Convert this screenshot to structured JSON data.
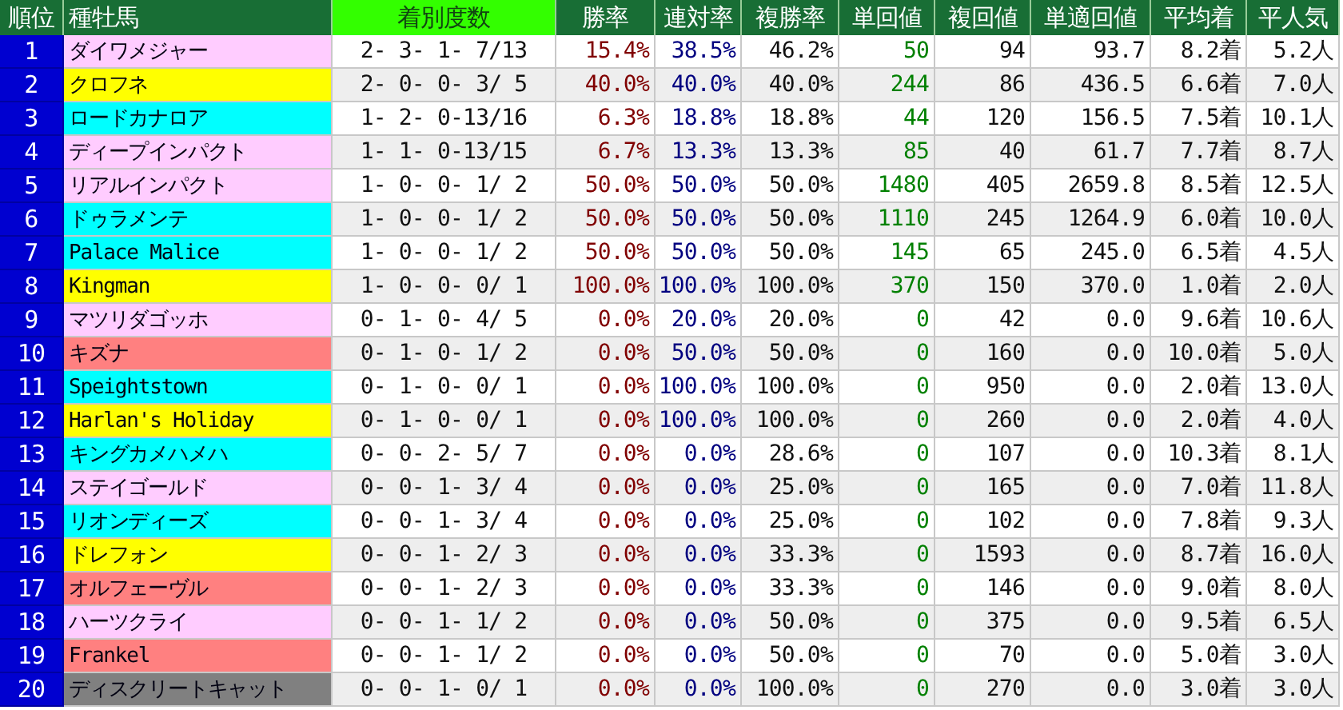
{
  "table": {
    "columns": [
      {
        "label": "順位",
        "selected": false
      },
      {
        "label": "種牡馬",
        "selected": false
      },
      {
        "label": "着別度数",
        "selected": true
      },
      {
        "label": "勝率",
        "selected": false
      },
      {
        "label": "連対率",
        "selected": false
      },
      {
        "label": "複勝率",
        "selected": false
      },
      {
        "label": "単回値",
        "selected": false
      },
      {
        "label": "複回値",
        "selected": false
      },
      {
        "label": "単適回値",
        "selected": false
      },
      {
        "label": "平均着",
        "selected": false
      },
      {
        "label": "平人気",
        "selected": false
      }
    ],
    "rows": [
      {
        "rank": "1",
        "sire": "ダイワメジャー",
        "color": "#ffccff",
        "record": "2- 3- 1- 7/13",
        "win_rate": "15.4%",
        "place_rate": "38.5%",
        "show_rate": "46.2%",
        "win_return": "50",
        "show_return": "94",
        "adj_win_return": "93.7",
        "avg_finish": "8.2着",
        "avg_pop": "5.2人"
      },
      {
        "rank": "2",
        "sire": "クロフネ",
        "color": "#ffff00",
        "record": "2- 0- 0- 3/ 5",
        "win_rate": "40.0%",
        "place_rate": "40.0%",
        "show_rate": "40.0%",
        "win_return": "244",
        "show_return": "86",
        "adj_win_return": "436.5",
        "avg_finish": "6.6着",
        "avg_pop": "7.0人"
      },
      {
        "rank": "3",
        "sire": "ロードカナロア",
        "color": "#00ffff",
        "record": "1- 2- 0-13/16",
        "win_rate": "6.3%",
        "place_rate": "18.8%",
        "show_rate": "18.8%",
        "win_return": "44",
        "show_return": "120",
        "adj_win_return": "156.5",
        "avg_finish": "7.5着",
        "avg_pop": "10.1人"
      },
      {
        "rank": "4",
        "sire": "ディープインパクト",
        "color": "#ffccff",
        "record": "1- 1- 0-13/15",
        "win_rate": "6.7%",
        "place_rate": "13.3%",
        "show_rate": "13.3%",
        "win_return": "85",
        "show_return": "40",
        "adj_win_return": "61.7",
        "avg_finish": "7.7着",
        "avg_pop": "8.7人"
      },
      {
        "rank": "5",
        "sire": "リアルインパクト",
        "color": "#ffccff",
        "record": "1- 0- 0- 1/ 2",
        "win_rate": "50.0%",
        "place_rate": "50.0%",
        "show_rate": "50.0%",
        "win_return": "1480",
        "show_return": "405",
        "adj_win_return": "2659.8",
        "avg_finish": "8.5着",
        "avg_pop": "12.5人"
      },
      {
        "rank": "6",
        "sire": "ドゥラメンテ",
        "color": "#00ffff",
        "record": "1- 0- 0- 1/ 2",
        "win_rate": "50.0%",
        "place_rate": "50.0%",
        "show_rate": "50.0%",
        "win_return": "1110",
        "show_return": "245",
        "adj_win_return": "1264.9",
        "avg_finish": "6.0着",
        "avg_pop": "10.0人"
      },
      {
        "rank": "7",
        "sire": "Palace Malice",
        "color": "#00ffff",
        "record": "1- 0- 0- 1/ 2",
        "win_rate": "50.0%",
        "place_rate": "50.0%",
        "show_rate": "50.0%",
        "win_return": "145",
        "show_return": "65",
        "adj_win_return": "245.0",
        "avg_finish": "6.5着",
        "avg_pop": "4.5人"
      },
      {
        "rank": "8",
        "sire": "Kingman",
        "color": "#ffff00",
        "record": "1- 0- 0- 0/ 1",
        "win_rate": "100.0%",
        "place_rate": "100.0%",
        "show_rate": "100.0%",
        "win_return": "370",
        "show_return": "150",
        "adj_win_return": "370.0",
        "avg_finish": "1.0着",
        "avg_pop": "2.0人"
      },
      {
        "rank": "9",
        "sire": "マツリダゴッホ",
        "color": "#ffccff",
        "record": "0- 1- 0- 4/ 5",
        "win_rate": "0.0%",
        "place_rate": "20.0%",
        "show_rate": "20.0%",
        "win_return": "0",
        "show_return": "42",
        "adj_win_return": "0.0",
        "avg_finish": "9.6着",
        "avg_pop": "10.6人"
      },
      {
        "rank": "10",
        "sire": "キズナ",
        "color": "#ff8080",
        "record": "0- 1- 0- 1/ 2",
        "win_rate": "0.0%",
        "place_rate": "50.0%",
        "show_rate": "50.0%",
        "win_return": "0",
        "show_return": "160",
        "adj_win_return": "0.0",
        "avg_finish": "10.0着",
        "avg_pop": "5.0人"
      },
      {
        "rank": "11",
        "sire": "Speightstown",
        "color": "#00ffff",
        "record": "0- 1- 0- 0/ 1",
        "win_rate": "0.0%",
        "place_rate": "100.0%",
        "show_rate": "100.0%",
        "win_return": "0",
        "show_return": "950",
        "adj_win_return": "0.0",
        "avg_finish": "2.0着",
        "avg_pop": "13.0人"
      },
      {
        "rank": "12",
        "sire": "Harlan's Holiday",
        "color": "#ffff00",
        "record": "0- 1- 0- 0/ 1",
        "win_rate": "0.0%",
        "place_rate": "100.0%",
        "show_rate": "100.0%",
        "win_return": "0",
        "show_return": "260",
        "adj_win_return": "0.0",
        "avg_finish": "2.0着",
        "avg_pop": "4.0人"
      },
      {
        "rank": "13",
        "sire": "キングカメハメハ",
        "color": "#00ffff",
        "record": "0- 0- 2- 5/ 7",
        "win_rate": "0.0%",
        "place_rate": "0.0%",
        "show_rate": "28.6%",
        "win_return": "0",
        "show_return": "107",
        "adj_win_return": "0.0",
        "avg_finish": "10.3着",
        "avg_pop": "8.1人"
      },
      {
        "rank": "14",
        "sire": "ステイゴールド",
        "color": "#ffccff",
        "record": "0- 0- 1- 3/ 4",
        "win_rate": "0.0%",
        "place_rate": "0.0%",
        "show_rate": "25.0%",
        "win_return": "0",
        "show_return": "165",
        "adj_win_return": "0.0",
        "avg_finish": "7.0着",
        "avg_pop": "11.8人"
      },
      {
        "rank": "15",
        "sire": "リオンディーズ",
        "color": "#00ffff",
        "record": "0- 0- 1- 3/ 4",
        "win_rate": "0.0%",
        "place_rate": "0.0%",
        "show_rate": "25.0%",
        "win_return": "0",
        "show_return": "102",
        "adj_win_return": "0.0",
        "avg_finish": "7.8着",
        "avg_pop": "9.3人"
      },
      {
        "rank": "16",
        "sire": "ドレフォン",
        "color": "#ffff00",
        "record": "0- 0- 1- 2/ 3",
        "win_rate": "0.0%",
        "place_rate": "0.0%",
        "show_rate": "33.3%",
        "win_return": "0",
        "show_return": "1593",
        "adj_win_return": "0.0",
        "avg_finish": "8.7着",
        "avg_pop": "16.0人"
      },
      {
        "rank": "17",
        "sire": "オルフェーヴル",
        "color": "#ff8080",
        "record": "0- 0- 1- 2/ 3",
        "win_rate": "0.0%",
        "place_rate": "0.0%",
        "show_rate": "33.3%",
        "win_return": "0",
        "show_return": "146",
        "adj_win_return": "0.0",
        "avg_finish": "9.0着",
        "avg_pop": "8.0人"
      },
      {
        "rank": "18",
        "sire": "ハーツクライ",
        "color": "#ffccff",
        "record": "0- 0- 1- 1/ 2",
        "win_rate": "0.0%",
        "place_rate": "0.0%",
        "show_rate": "50.0%",
        "win_return": "0",
        "show_return": "375",
        "adj_win_return": "0.0",
        "avg_finish": "9.5着",
        "avg_pop": "6.5人"
      },
      {
        "rank": "19",
        "sire": "Frankel",
        "color": "#ff8080",
        "record": "0- 0- 1- 1/ 2",
        "win_rate": "0.0%",
        "place_rate": "0.0%",
        "show_rate": "50.0%",
        "win_return": "0",
        "show_return": "70",
        "adj_win_return": "0.0",
        "avg_finish": "5.0着",
        "avg_pop": "3.0人"
      },
      {
        "rank": "20",
        "sire": "ディスクリートキャット",
        "color": "#808080",
        "record": "0- 0- 1- 0/ 1",
        "win_rate": "0.0%",
        "place_rate": "0.0%",
        "show_rate": "100.0%",
        "win_return": "0",
        "show_return": "270",
        "adj_win_return": "0.0",
        "avg_finish": "3.0着",
        "avg_pop": "3.0人"
      }
    ]
  }
}
